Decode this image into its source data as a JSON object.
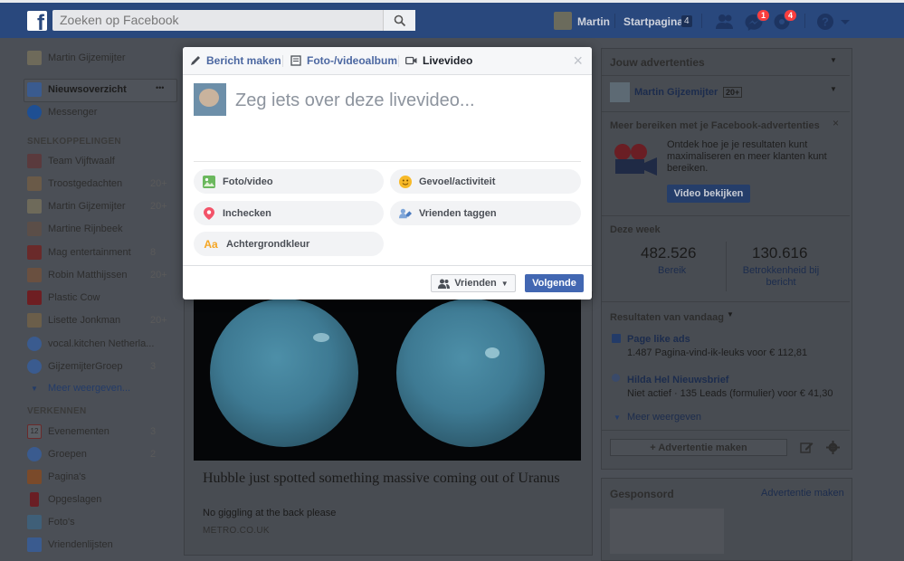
{
  "topbar": {
    "logo": "f",
    "search_placeholder": "Zoeken op Facebook",
    "profile_name": "Martin",
    "home_label": "Startpagina",
    "home_count": "4",
    "messages_badge": "1",
    "notifications_badge": "4"
  },
  "left": {
    "profile_name": "Martin Gijzemijter",
    "news_feed": "Nieuwsoverzicht",
    "more_dots": "•••",
    "messenger": "Messenger",
    "shortcuts_heading": "SNELKOPPELINGEN",
    "shortcuts": [
      {
        "label": "Team Vijftwaalf",
        "count": ""
      },
      {
        "label": "Troostgedachten",
        "count": "20+"
      },
      {
        "label": "Martin Gijzemijter",
        "count": "20+"
      },
      {
        "label": "Martine Rijnbeek",
        "count": ""
      },
      {
        "label": "Mag entertainment",
        "count": "8"
      },
      {
        "label": "Robin Matthijssen",
        "count": "20+"
      },
      {
        "label": "Plastic Cow",
        "count": ""
      },
      {
        "label": "Lisette Jonkman",
        "count": "20+"
      },
      {
        "label": "vocal.kitchen Netherla...",
        "count": ""
      },
      {
        "label": "GijzemijterGroep",
        "count": "3"
      }
    ],
    "more_shortcuts": "Meer weergeven...",
    "explore_heading": "VERKENNEN",
    "explore": [
      {
        "label": "Evenementen",
        "count": "3"
      },
      {
        "label": "Groepen",
        "count": "2"
      },
      {
        "label": "Pagina's",
        "count": ""
      },
      {
        "label": "Opgeslagen",
        "count": ""
      },
      {
        "label": "Foto's",
        "count": ""
      },
      {
        "label": "Vriendenlijsten",
        "count": ""
      }
    ],
    "calendar_day": "12"
  },
  "modal": {
    "tabs": [
      "Bericht maken",
      "Foto-/videoalbum",
      "Livevideo"
    ],
    "close": "×",
    "prompt": "Zeg iets over deze livevideo...",
    "options": [
      "Foto/video",
      "Gevoel/activiteit",
      "Inchecken",
      "Vrienden taggen",
      "Achtergrondkleur"
    ],
    "audience": "Vrienden",
    "next": "Volgende"
  },
  "post": {
    "title": "Hubble just spotted something massive coming out of Uranus",
    "subtitle": "No giggling at the back please",
    "source": "METRO.CO.UK"
  },
  "right": {
    "ads_heading": "Jouw advertenties",
    "page_name": "Martin Gijzemijter",
    "page_count": "20+",
    "promo_title": "Meer bereiken met je Facebook-advertenties",
    "promo_text": "Ontdek hoe je je resultaten kunt maximaliseren en meer klanten kunt bereiken.",
    "promo_button": "Video bekijken",
    "week_heading": "Deze week",
    "reach_value": "482.526",
    "reach_label": "Bereik",
    "engagement_value": "130.616",
    "engagement_label": "Betrokkenheid bij bericht",
    "today_heading": "Resultaten van vandaag",
    "result1_title": "Page like ads",
    "result1_text": "1.487 Pagina-vind-ik-leuks voor € 112,81",
    "result2_title": "Hilda Hel Nieuwsbrief",
    "result2_text": "Niet actief · 135 Leads (formulier) voor € 41,30",
    "more": "Meer weergeven",
    "create_ad": "+ Advertentie maken",
    "sponsored": "Gesponsord",
    "sponsored_link": "Advertentie maken"
  }
}
